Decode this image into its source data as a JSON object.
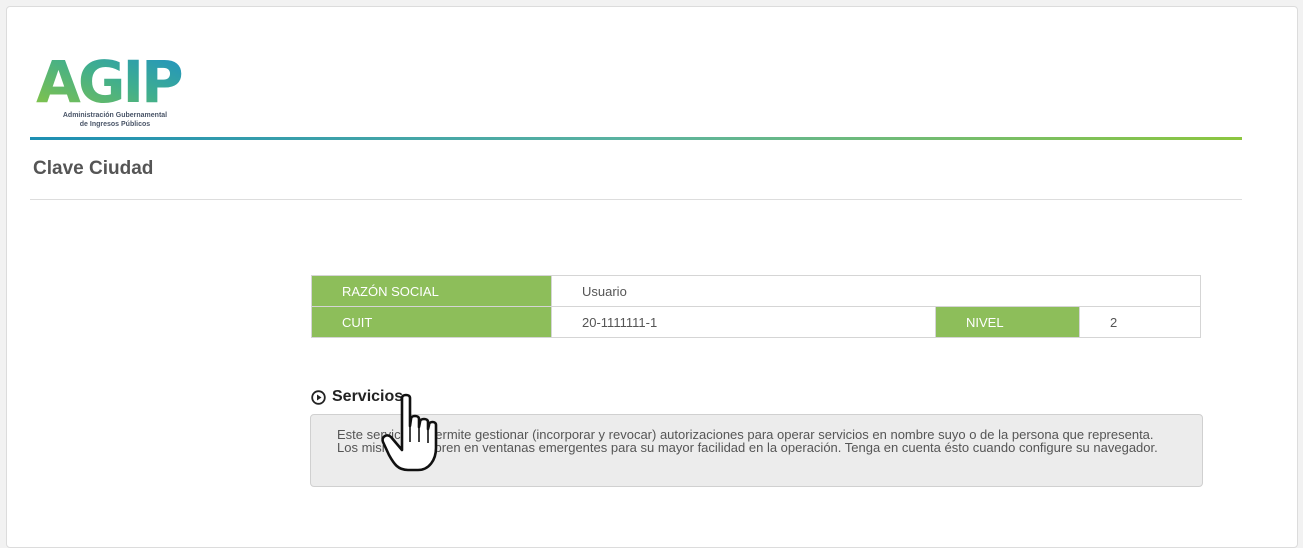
{
  "header": {
    "logo_text": "AGIP",
    "logo_subtitle_line1": "Administración Gubernamental",
    "logo_subtitle_line2": "de Ingresos Públicos"
  },
  "page": {
    "title": "Clave Ciudad"
  },
  "info_table": {
    "razon_social_label": "RAZÓN SOCIAL",
    "razon_social_value": "Usuario",
    "cuit_label": "CUIT",
    "cuit_value": "20-1111111-1",
    "nivel_label": "NIVEL",
    "nivel_value": "2"
  },
  "services": {
    "heading": "Servicios",
    "description": "Este servicio le permite gestionar (incorporar y revocar) autorizaciones para operar servicios en nombre suyo o de la persona que representa. Los mismos se abren en ventanas emergentes para su mayor facilidad en la operación. Tenga en cuenta ésto cuando configure su navegador."
  },
  "colors": {
    "label_green": "#8dbe5a",
    "accent_blue": "#1d8fb3",
    "accent_green": "#8cc63f"
  }
}
